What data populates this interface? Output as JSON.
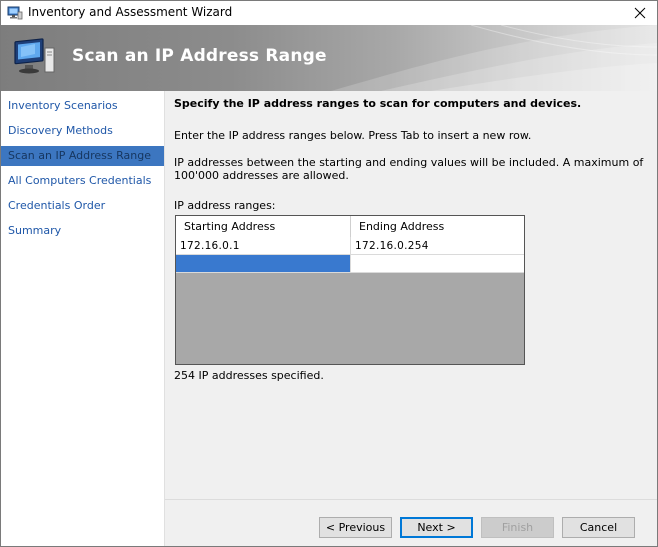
{
  "window": {
    "title": "Inventory and Assessment Wizard"
  },
  "banner": {
    "title": "Scan an IP Address Range",
    "icon": "computer-monitor-icon"
  },
  "nav": {
    "items": [
      {
        "label": "Inventory Scenarios",
        "selected": false
      },
      {
        "label": "Discovery Methods",
        "selected": false
      },
      {
        "label": "Scan an IP Address Range",
        "selected": true
      },
      {
        "label": "All Computers Credentials",
        "selected": false
      },
      {
        "label": "Credentials Order",
        "selected": false
      },
      {
        "label": "Summary",
        "selected": false
      }
    ]
  },
  "content": {
    "heading": "Specify the IP address ranges to scan for computers and devices.",
    "instruction": "Enter the IP address ranges below. Press Tab to insert a new row.",
    "info": "IP addresses between the starting and ending values will be included. A maximum of 100'000 addresses are allowed.",
    "grid_label": "IP address ranges:",
    "grid": {
      "columns": [
        "Starting Address",
        "Ending Address"
      ],
      "rows": [
        [
          "172.16.0.1",
          "172.16.0.254"
        ],
        [
          "",
          ""
        ]
      ]
    },
    "count_text": "254 IP addresses specified."
  },
  "footer": {
    "previous_label": "< Previous",
    "next_label": "Next >",
    "finish_label": "Finish",
    "cancel_label": "Cancel"
  },
  "colors": {
    "selected_nav": "#3c76c0",
    "link": "#1f57a8",
    "active_cell": "#3979cf",
    "grid_empty_area": "#a8a8a8"
  }
}
